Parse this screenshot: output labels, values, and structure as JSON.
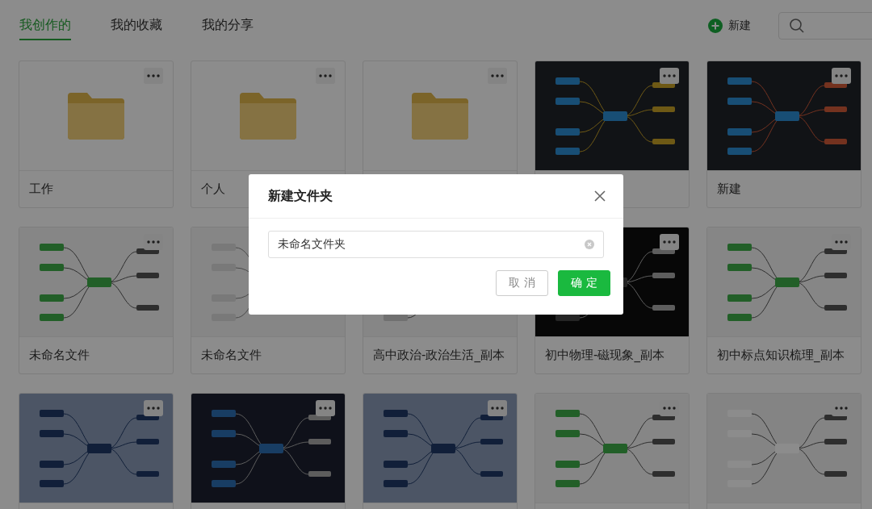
{
  "tabs": [
    {
      "label": "我创作的",
      "selected": true
    },
    {
      "label": "我的收藏",
      "selected": false
    },
    {
      "label": "我的分享",
      "selected": false
    }
  ],
  "new_button": {
    "label": "新建"
  },
  "cards": [
    {
      "kind": "folder",
      "title": "工作",
      "more_button": true
    },
    {
      "kind": "folder",
      "title": "个人",
      "more_button": true
    },
    {
      "kind": "folder",
      "more_button": true
    },
    {
      "kind": "picture",
      "more_button": true
    },
    {
      "kind": "picture",
      "title": "新建",
      "more_button": true
    },
    {
      "kind": "picture",
      "title": "未命名文件",
      "more_button": true
    },
    {
      "kind": "picture",
      "title": "未命名文件",
      "more_button": false
    },
    {
      "kind": "picture",
      "title": "高中政治-政治生活_副本",
      "more_button": false
    },
    {
      "kind": "picture",
      "title": "初中物理-磁现象_副本",
      "more_button": true
    },
    {
      "kind": "picture",
      "title": "初中标点知识梳理_副本",
      "more_button": true
    },
    {
      "kind": "picture",
      "more_button": true
    },
    {
      "kind": "picture",
      "more_button": true
    },
    {
      "kind": "picture",
      "more_button": true
    },
    {
      "kind": "picture",
      "more_button": true
    },
    {
      "kind": "picture",
      "more_button": true
    }
  ],
  "dialog": {
    "title": "新建文件夹",
    "input_value": "未命名文件夹",
    "buttons": [
      {
        "label": "取 消",
        "kind": "secondary"
      },
      {
        "label": "确 定",
        "kind": "primary"
      }
    ]
  }
}
